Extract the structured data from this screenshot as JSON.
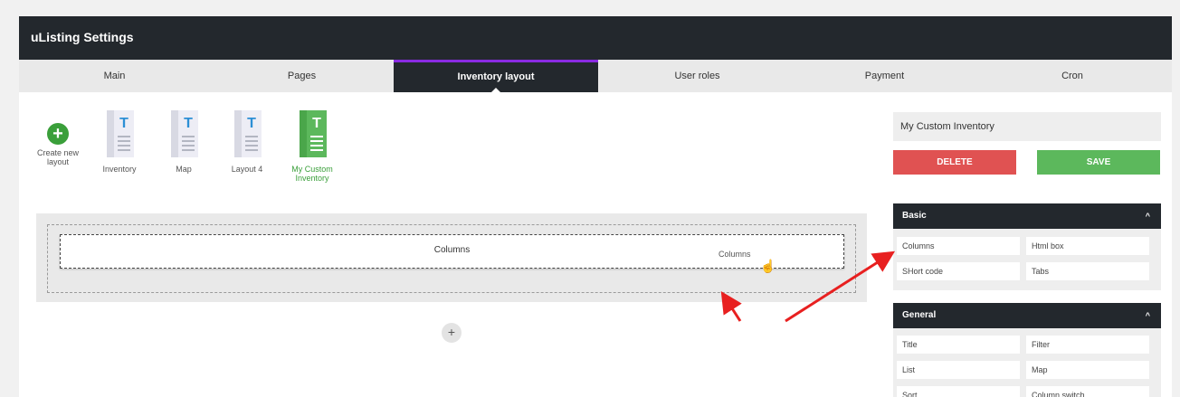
{
  "app": {
    "title": "uListing Settings"
  },
  "tabs": [
    {
      "label": "Main"
    },
    {
      "label": "Pages"
    },
    {
      "label": "Inventory layout"
    },
    {
      "label": "User roles"
    },
    {
      "label": "Payment"
    },
    {
      "label": "Cron"
    }
  ],
  "active_tab": "Inventory layout",
  "accent_color": "#8a2be2",
  "layouts": {
    "create_label": "Create new layout",
    "items": [
      {
        "label": "Inventory",
        "selected": false
      },
      {
        "label": "Map",
        "selected": false
      },
      {
        "label": "Layout 4",
        "selected": false
      },
      {
        "label": "My Custom Inventory",
        "selected": true
      }
    ],
    "doc_letter": "T"
  },
  "builder": {
    "columns_label": "Columns",
    "drag_ghost_label": "Columns",
    "add_symbol": "+"
  },
  "sidebar": {
    "layout_name": "My Custom Inventory",
    "delete_label": "DELETE",
    "save_label": "SAVE",
    "basic": {
      "title": "Basic",
      "chevron": "^",
      "items": [
        "Columns",
        "Html box",
        "SHort code",
        "Tabs"
      ]
    },
    "general": {
      "title": "General",
      "chevron": "^",
      "items": [
        "Title",
        "Filter",
        "List",
        "Map",
        "Sort",
        "Column switch"
      ]
    }
  },
  "colors": {
    "dark": "#23282d",
    "delete": "#e05252",
    "save": "#5cb85c",
    "annotation_arrow": "#e82020"
  }
}
